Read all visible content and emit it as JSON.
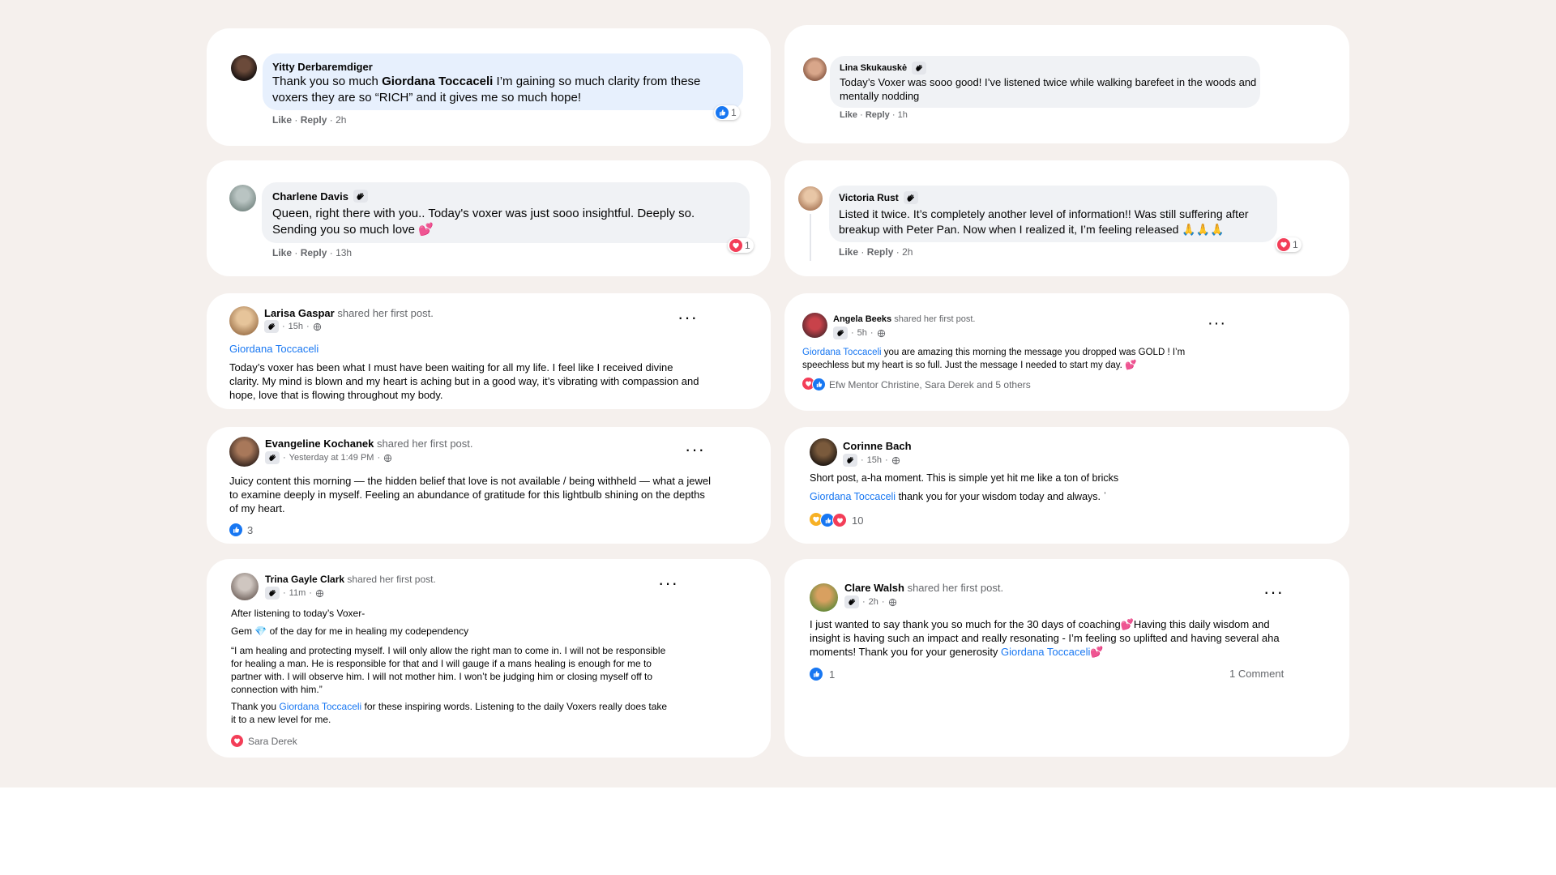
{
  "colors": {
    "background": "#f5f0ed",
    "card": "#ffffff",
    "link": "#1877f2",
    "muted": "#65676b",
    "like": "#1877f2",
    "love": "#f33e58"
  },
  "c1": {
    "author": "Yitty Derbaremdiger",
    "text_pre": "Thank you so much ",
    "mention": "Giordana Toccaceli",
    "text_post": " I’m gaining so much clarity from these voxers they are so “RICH” and it gives me so much hope!",
    "like": "Like",
    "reply": "Reply",
    "time": "2h",
    "reaction_count": "1",
    "reaction_icon": "like"
  },
  "c2": {
    "author": "Lina Skukauskė",
    "text": "Today’s Voxer was sooo good! I’ve listened twice while walking barefeet in the woods and mentally nodding",
    "like": "Like",
    "reply": "Reply",
    "time": "1h"
  },
  "c3": {
    "author": "Charlene Davis",
    "text": "Queen, right there with you.. Today's voxer was just sooo insightful. Deeply so. Sending you so much love 💕",
    "like": "Like",
    "reply": "Reply",
    "time": "13h",
    "reaction_count": "1",
    "reaction_icon": "love"
  },
  "c4": {
    "author": "Victoria Rust",
    "text": "Listed it twice. It’s completely another level of information!! Was still suffering after breakup with Peter Pan. Now when I realized it, I’m feeling released 🙏🙏🙏",
    "like": "Like",
    "reply": "Reply",
    "time": "2h",
    "reaction_count": "1",
    "reaction_icon": "love"
  },
  "p1": {
    "author": "Larisa Gaspar",
    "shared": "shared her first post.",
    "time": "15h",
    "mention": "Giordana Toccaceli",
    "text": "Today’s voxer has been what I must have been waiting for all my life. I feel like I received divine clarity. My mind is blown and my heart is aching but in a good way, it’s vibrating with compassion and hope, love that is flowing throughout my body."
  },
  "p2": {
    "author": "Angela Beeks",
    "shared": "shared her first post.",
    "time": "5h",
    "mention": "Giordana Toccaceli",
    "text": " you are amazing this morning the message you dropped was GOLD ! I’m speechless but my heart is so full.  Just the message I needed to start my day. 💕",
    "reactions": "Efw Mentor Christine, Sara Derek and 5 others"
  },
  "p3": {
    "author": "Evangeline Kochanek",
    "shared": "shared her first post.",
    "time": "Yesterday at 1:49 PM",
    "text": "Juicy content this morning — the hidden belief that love is not available / being withheld — what a jewel to examine deeply in myself. Feeling an abundance of gratitude for this lightbulb shining on the depths of my heart.",
    "reaction_count": "3"
  },
  "p4": {
    "author": "Corinne Bach",
    "time": "15h",
    "text": "Short post, a-ha moment. This is simple yet hit me like a ton of bricks",
    "mention": "Giordana Toccaceli",
    "text2": " thank you for your wisdom today and always. ˈ",
    "reaction_count": "10"
  },
  "p5": {
    "author": "Trina Gayle Clark",
    "shared": "shared her first post.",
    "time": "11m",
    "line1": "After listening to today’s Voxer-",
    "line2_pre": "Gem ",
    "line2_post": " of the day for me in healing my codependency",
    "quote": "“I am healing and protecting myself. I will only allow the right man to come in. I will not be responsible for healing a man. He is responsible for that and I will gauge if a mans healing is enough for me to partner with. I will observe him. I will not mother him. I won’t be judging him or closing myself off to connection with him.”",
    "thanks_pre": "Thank you ",
    "mention": "Giordana Toccaceli",
    "thanks_post": " for these inspiring words. Listening to the daily Voxers really does take it to a new level for me.",
    "reactions": "Sara Derek"
  },
  "p6": {
    "author": "Clare Walsh",
    "shared": "shared her first post.",
    "time": "2h",
    "text": "I just wanted to say thank you so much for the 30 days of coaching💕Having this daily wisdom and insight is having such an impact and really resonating - I’m feeling so uplifted and having several aha moments! Thank you for your generosity ",
    "mention": "Giordana Toccaceli",
    "text_end": "💕",
    "reaction_count": "1",
    "comments": "1 Comment"
  },
  "sep": "·",
  "dots": "···"
}
